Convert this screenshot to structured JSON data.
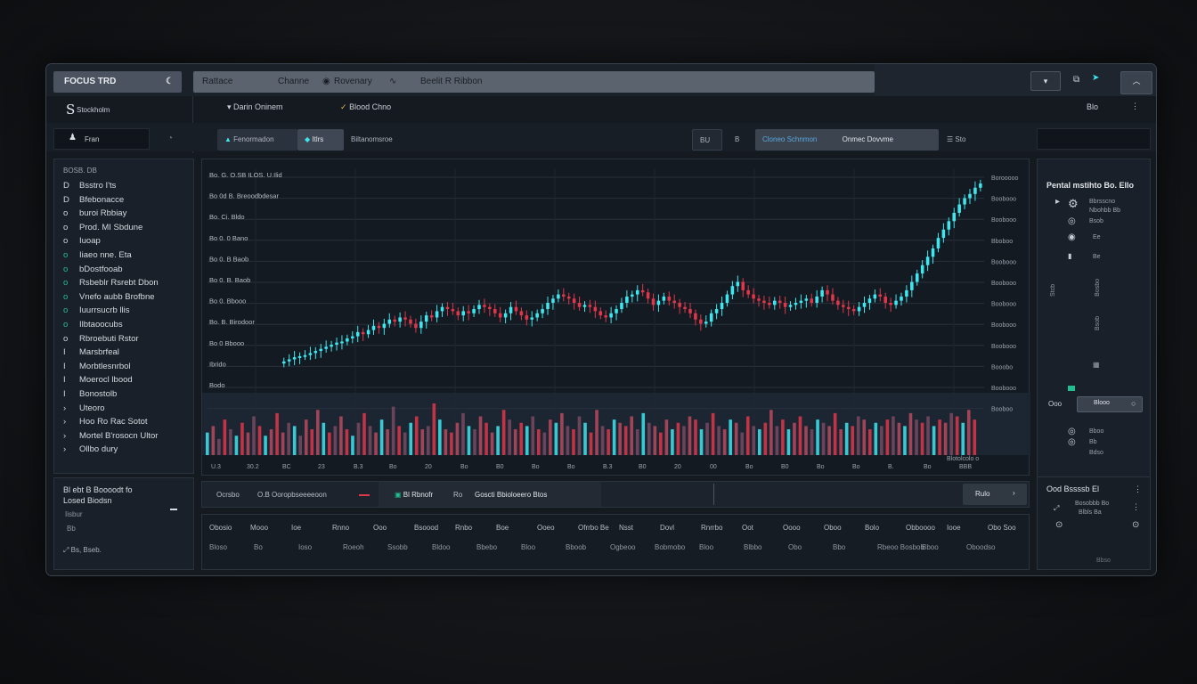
{
  "app": {
    "logo": "FOCUS TRD",
    "brand": "S",
    "brand_sub": "Stockholm"
  },
  "topnav": {
    "items": [
      "Rattace",
      "Channe",
      "Rovenary",
      "Beelit R Ribbon"
    ]
  },
  "subbar": {
    "left1": "Darin Oninem",
    "left2": "Blood Chno",
    "right": "Blo"
  },
  "toolbar": {
    "account": "Fran",
    "chips": [
      "Fenormadon",
      "Itlrs",
      "Biltanomsroe"
    ],
    "mini1": "BU",
    "mini2": "B",
    "tab_active": "Cloneo Schnmon",
    "tab2": "Onmec Dovvme",
    "tab3": "Sto"
  },
  "sidebar": {
    "header": "BOSB. DB",
    "items": [
      {
        "icon": "D",
        "label": "Bsstro I'ts"
      },
      {
        "icon": "D",
        "label": "Bfebonacce"
      },
      {
        "icon": "o",
        "label": "buroi Rbbiay"
      },
      {
        "icon": "o",
        "label": "Prod. MI Sbdune"
      },
      {
        "icon": "o",
        "label": "Iuoap"
      },
      {
        "icon": "o",
        "label": "Iiaeo nne. Eta"
      },
      {
        "icon": "o",
        "label": "bDostfooab"
      },
      {
        "icon": "o",
        "label": "Rsbeblr Rsrebt Dbon"
      },
      {
        "icon": "o",
        "label": "Vnefo aubb Brofbne"
      },
      {
        "icon": "o",
        "label": "Iuurrsucrb llis"
      },
      {
        "icon": "o",
        "label": "Ilbtaoocubs"
      },
      {
        "icon": "o",
        "label": "Rbroebuti Rstor"
      },
      {
        "icon": "I",
        "label": "Marsbrfeal"
      },
      {
        "icon": "I",
        "label": "Morbtlesnrbol"
      },
      {
        "icon": "I",
        "label": "Moerocl lbood"
      },
      {
        "icon": "I",
        "label": "Bonostolb"
      },
      {
        "icon": "›",
        "label": "Uteoro"
      },
      {
        "icon": "›",
        "label": "Hoo Ro Rac Sotot"
      },
      {
        "icon": "›",
        "label": "Mortel B'rosocn Ultor"
      },
      {
        "icon": "›",
        "label": "Ollbo dury"
      }
    ],
    "footer_title": "Bl ebt B Boooodt fo",
    "footer_sub": "Losed Biodsn",
    "footer_line": "Iisbur",
    "footer_small": "Bb",
    "footer_bottom": "Bs, Bseb."
  },
  "chart_data": {
    "type": "candlestick",
    "title": "",
    "annotations": [
      "Bo. G. O.SB ILOS. U.Ilid",
      "Bo 0d B. Breoodbdesar",
      "Bo. Ci. Bldo",
      "Bo 0. 0 Bano",
      "Bo 0. B Baob",
      "Bo 0. B. Baob",
      "Bo 0. Bbooo",
      "Bo. B. Birodoor",
      "Bo 0 Bbooo",
      "Ibrido",
      "Bodo"
    ],
    "y_ticks": [
      "Borooooo",
      "Boobooo",
      "Boobooo",
      "Bboboo",
      "Boobooo",
      "Boobooo",
      "Boobooo",
      "Boobooo",
      "Boobooo",
      "Booobo",
      "Boobooo",
      "Booboo"
    ],
    "x_ticks": [
      "U.3",
      "30.2",
      "BC",
      "23",
      "B.3",
      "Bo",
      "20",
      "Bo",
      "B0",
      "Bo",
      "Bo",
      "B.3",
      "B0",
      "20",
      "00",
      "Bo",
      "B0",
      "Bo",
      "Bo",
      "B.",
      "Bo",
      "BBB"
    ],
    "corner_label": "Blotolcolo o",
    "close": [
      12,
      13,
      14,
      14.5,
      15,
      16,
      17,
      18,
      19,
      20,
      21,
      21.5,
      23,
      24,
      26,
      25,
      27,
      29,
      28,
      30,
      32,
      31,
      33,
      32,
      30,
      28,
      31,
      34,
      33,
      36,
      38,
      37,
      36,
      34,
      36,
      35,
      37,
      39,
      38,
      37,
      35,
      33,
      35,
      38,
      36,
      34,
      32,
      33,
      35,
      37,
      40,
      42,
      44,
      43,
      42,
      40,
      38,
      39,
      38,
      36,
      34,
      33,
      35,
      37,
      40,
      43,
      44,
      46,
      45,
      42,
      39,
      41,
      43,
      41,
      40,
      38,
      37,
      35,
      32,
      30,
      31,
      35,
      37,
      40,
      44,
      48,
      50,
      46,
      44,
      42,
      41,
      40,
      39,
      41,
      40,
      38,
      39,
      40,
      41,
      42,
      40,
      43,
      46,
      44,
      41,
      39,
      38,
      37,
      36,
      38,
      40,
      42,
      44,
      43,
      40,
      39,
      41,
      43,
      46,
      50,
      54,
      58,
      62,
      66,
      71,
      75,
      79,
      83,
      87,
      90,
      92,
      95,
      97
    ],
    "volume": [
      7,
      9,
      5,
      11,
      8,
      6,
      10,
      7,
      12,
      9,
      6,
      8,
      13,
      7,
      10,
      9,
      6,
      11,
      8,
      14,
      10,
      7,
      9,
      12,
      8,
      6,
      10,
      13,
      9,
      7,
      11,
      8,
      15,
      9,
      7,
      10,
      12,
      8,
      9,
      16,
      11,
      8,
      7,
      10,
      13,
      9,
      8,
      12,
      10,
      7,
      9,
      14,
      11,
      8,
      10,
      9,
      12,
      8,
      7,
      11,
      10,
      13,
      9,
      8,
      12,
      10,
      7,
      14,
      9,
      8,
      11,
      10,
      9,
      12,
      8,
      13,
      10,
      9,
      7,
      11,
      8,
      10,
      9,
      12,
      11,
      8,
      10,
      13,
      9,
      8,
      11,
      10,
      7,
      12,
      9,
      8,
      10,
      14,
      9,
      11,
      8,
      10,
      12,
      9,
      8,
      11,
      10,
      9,
      13,
      8,
      10,
      9,
      12,
      11,
      8,
      10,
      9,
      11,
      12,
      10,
      9,
      13,
      11,
      10,
      12,
      9,
      11,
      10,
      13,
      12,
      10,
      14,
      11
    ]
  },
  "bottom_bar": {
    "tabs": [
      "Ocrsbo",
      "O.B Ooropbseeeeoon",
      "Bl Rbnofr",
      "Ro",
      "Goscti Bbioloeero Btos"
    ],
    "right_button": "Rulo"
  },
  "table": {
    "headers": [
      "Obosio",
      "Mooo",
      "Ioe",
      "Rnno",
      "Ooo",
      "Bsoood",
      "Rnbo",
      "Boe",
      "Ooeo",
      "Ofrrbo Be",
      "Nsst",
      "Dovl",
      "Rnrrbo",
      "Oot",
      "Oooo",
      "Oboo",
      "Bolo",
      "Obboooo",
      "Iooe",
      "Obo Soo"
    ],
    "row": [
      "Bloso",
      "Bo",
      "Ioso",
      "Roeoh",
      "Ssobb",
      "Bldoo",
      "Bbebo",
      "Bloo",
      "Bboob",
      "Ogbeoo",
      "Bobmobo",
      "Bloo",
      "Blbbo",
      "Obo",
      "Bbo",
      "Rbeoo Bosbob",
      "Bboo",
      "Oboodso"
    ]
  },
  "right_panel": {
    "title": "Pental mstihto Bo. Ello",
    "lines": [
      "Bbrsscno",
      "Nbohbb Bb",
      "Bsob",
      "Ee",
      "Be"
    ],
    "labels": [
      "Stcb",
      "Bosbo",
      "Bsob"
    ],
    "slider_label": "Ooo",
    "slider_value": "Blooo",
    "list": [
      "Bboo",
      "Bb",
      "Bdso"
    ],
    "footer_title": "Ood Bssssb El",
    "footer_lines": [
      "Bosobbb Bo",
      "Blbls Ba"
    ],
    "footer_small": "Bbso"
  },
  "colors": {
    "up": "#3ee6f0",
    "down": "#e0364a",
    "background": "#151a21",
    "grid": "#27303b"
  }
}
